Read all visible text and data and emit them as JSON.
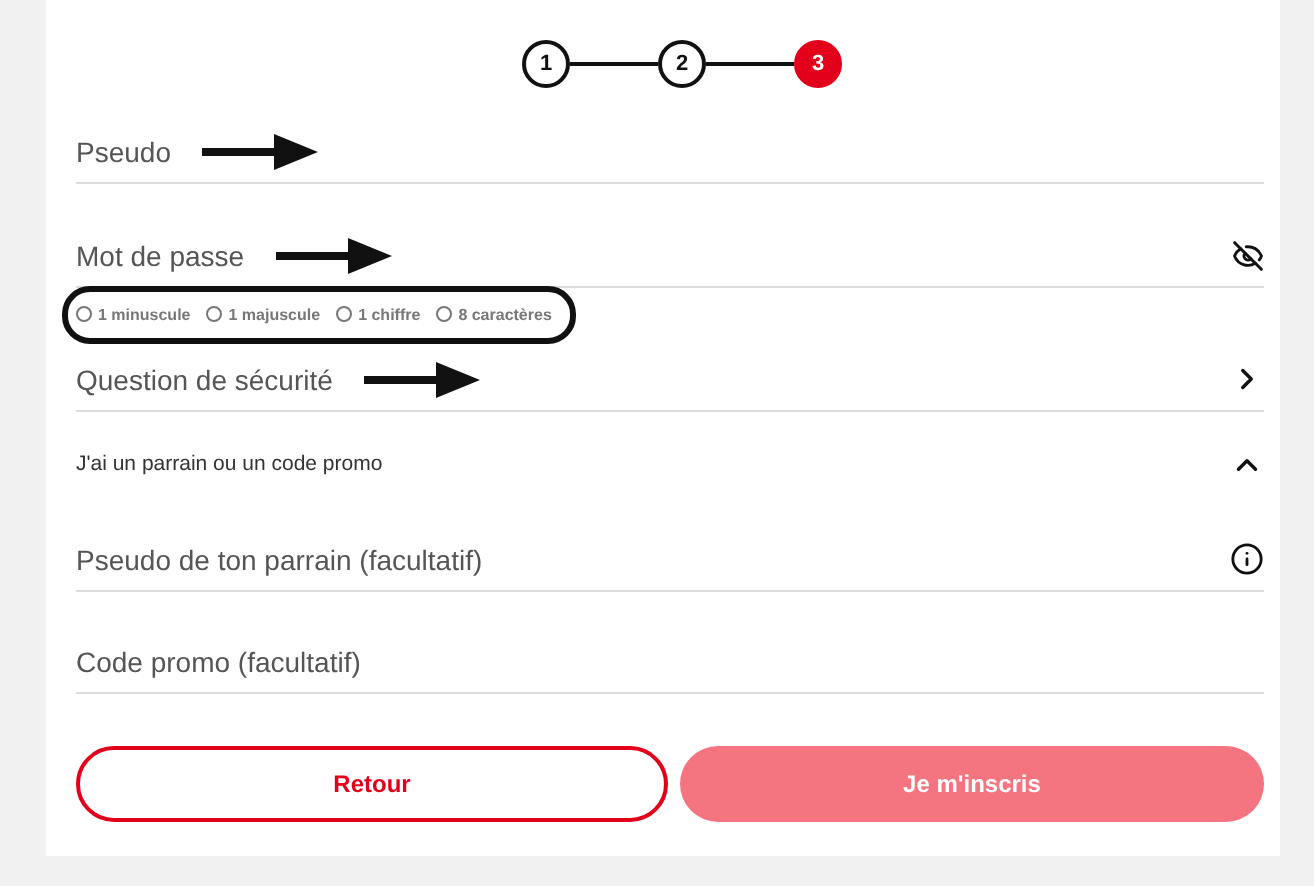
{
  "stepper": {
    "steps": [
      {
        "label": "1",
        "selected": false
      },
      {
        "label": "2",
        "selected": false
      },
      {
        "label": "3",
        "selected": true
      }
    ]
  },
  "fields": [
    {
      "kind": "text",
      "placeholder": "Pseudo",
      "arrow": true
    },
    {
      "kind": "password",
      "placeholder": "Mot de passe",
      "arrow": true
    }
  ],
  "password_rules": {
    "circled": true,
    "items": [
      {
        "label": "1 minuscule",
        "checked": false
      },
      {
        "label": "1 majuscule",
        "checked": false
      },
      {
        "label": "1 chiffre",
        "checked": false
      },
      {
        "label": "8 caractères",
        "checked": false
      }
    ]
  },
  "security_question": {
    "label": "Question de sécurité",
    "arrow": true
  },
  "promo_section": {
    "label": "J'ai un parrain ou un code promo",
    "expanded": true,
    "fields": [
      {
        "kind": "info",
        "placeholder": "Pseudo de ton parrain (facultatif)"
      },
      {
        "kind": "text",
        "placeholder": "Code promo (facultatif)"
      }
    ]
  },
  "buttons": {
    "back": {
      "label": "Retour"
    },
    "submit": {
      "label": "Je m'inscris",
      "disabled": true
    }
  }
}
